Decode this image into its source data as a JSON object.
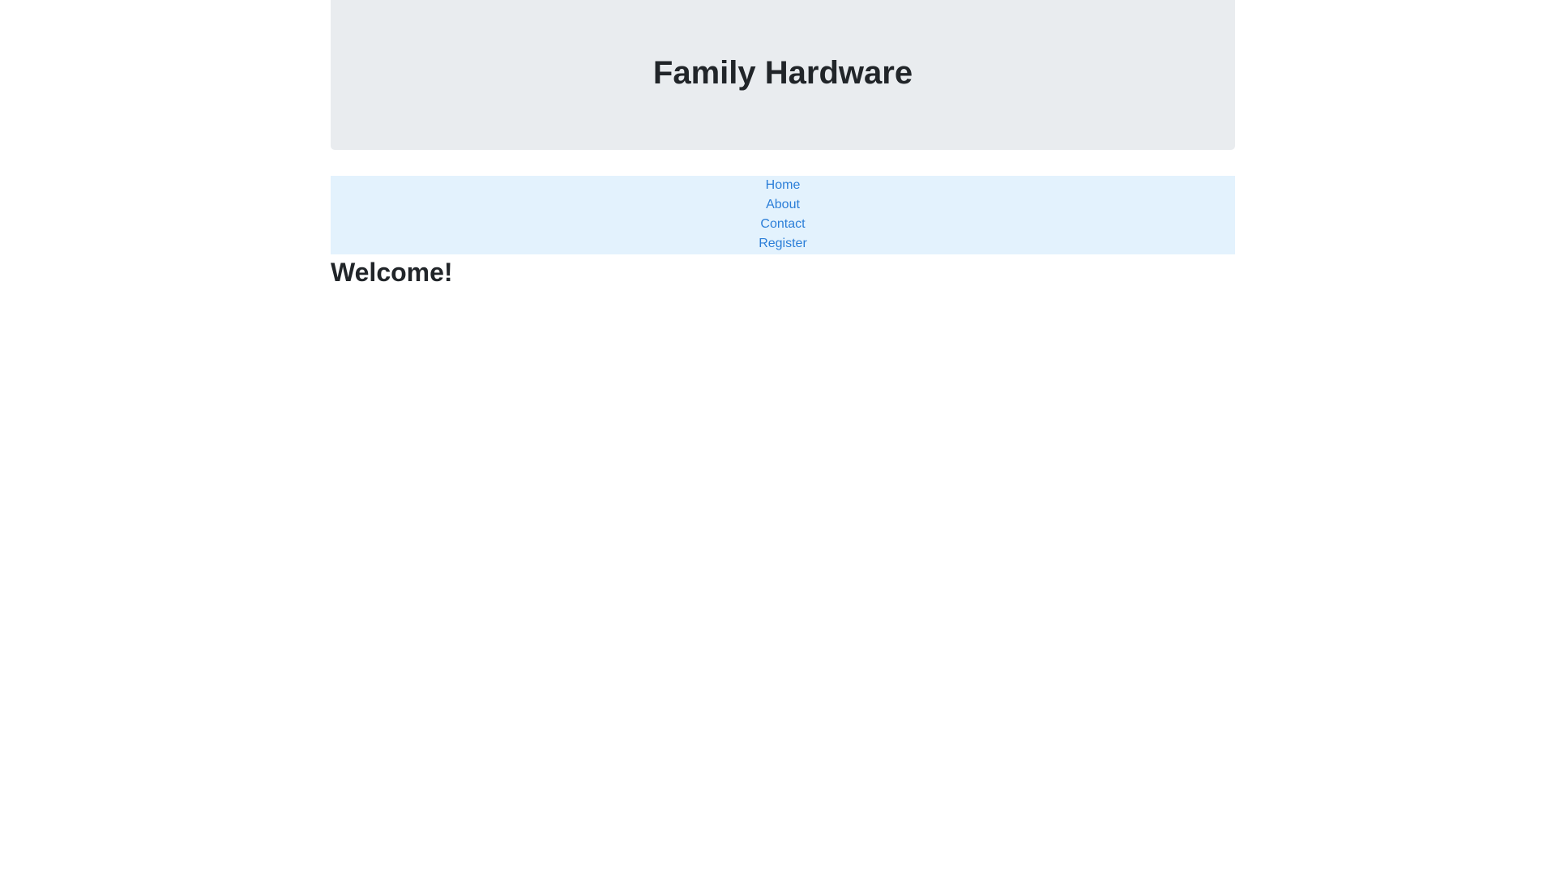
{
  "header": {
    "title": "Family Hardware"
  },
  "nav": {
    "items": [
      {
        "label": "Home"
      },
      {
        "label": "About"
      },
      {
        "label": "Contact"
      },
      {
        "label": "Register"
      }
    ]
  },
  "main": {
    "heading": "Welcome!"
  },
  "colors": {
    "jumbotron_bg": "#e9ecef",
    "nav_bg": "#e3f2fd",
    "link": "#2b7ed8",
    "text": "#212529"
  }
}
